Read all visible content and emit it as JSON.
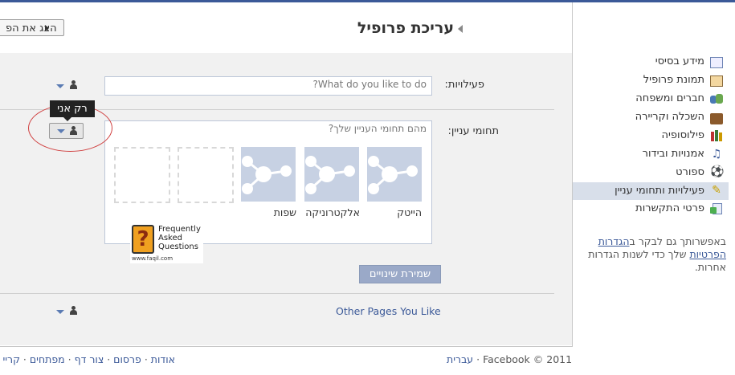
{
  "header": {
    "title": "עריכת פרופיל",
    "view_profile_label": "הצג את הפ"
  },
  "form": {
    "activities_label": "פעילויות:",
    "activities_placeholder": "What do you like to do?",
    "interests_label": "תחומי עניין:",
    "interests_placeholder": "מהם תחומי העניין שלך?",
    "interest_tiles": [
      {
        "label": "הייטק"
      },
      {
        "label": "אלקטרוניקה"
      },
      {
        "label": "שפות"
      }
    ],
    "privacy_tooltip": "רק אני",
    "save_label": "שמירת שינויים",
    "other_pages_label": "Other Pages You Like"
  },
  "faq_logo": {
    "line1": "Frequently",
    "line2": "Asked",
    "line3": "Questions",
    "url": "www.faqil.com"
  },
  "sidebar": {
    "items": [
      {
        "label": "מידע בסיסי",
        "icon": "id-card-icon"
      },
      {
        "label": "תמונת פרופיל",
        "icon": "profile-picture-icon"
      },
      {
        "label": "חברים ומשפחה",
        "icon": "friends-family-icon"
      },
      {
        "label": "השכלה וקריירה",
        "icon": "briefcase-icon"
      },
      {
        "label": "פילוסופיה",
        "icon": "books-icon"
      },
      {
        "label": "אמנויות ובידור",
        "icon": "music-icon"
      },
      {
        "label": "ספורט",
        "icon": "soccer-ball-icon"
      },
      {
        "label": "פעילויות ותחומי עניין",
        "icon": "pencil-icon",
        "active": true
      },
      {
        "label": "פרטי התקשרות",
        "icon": "contact-icon"
      }
    ],
    "note_before": "באפשרותך גם לבקר ב",
    "note_link": "הגדרות הפרטיות",
    "note_after": " שלך כדי לשנות הגדרות אחרות."
  },
  "footer": {
    "copyright": "Facebook © 2011",
    "language": "עברית",
    "links": [
      "אודות",
      "פרסום",
      "צור דף",
      "מפתחים",
      "קריי"
    ]
  },
  "colors": {
    "brand": "#3b5998",
    "active_bg": "#d8dfea",
    "tile_bg": "#c7d1e3",
    "save_button": "#9aa9c8"
  }
}
